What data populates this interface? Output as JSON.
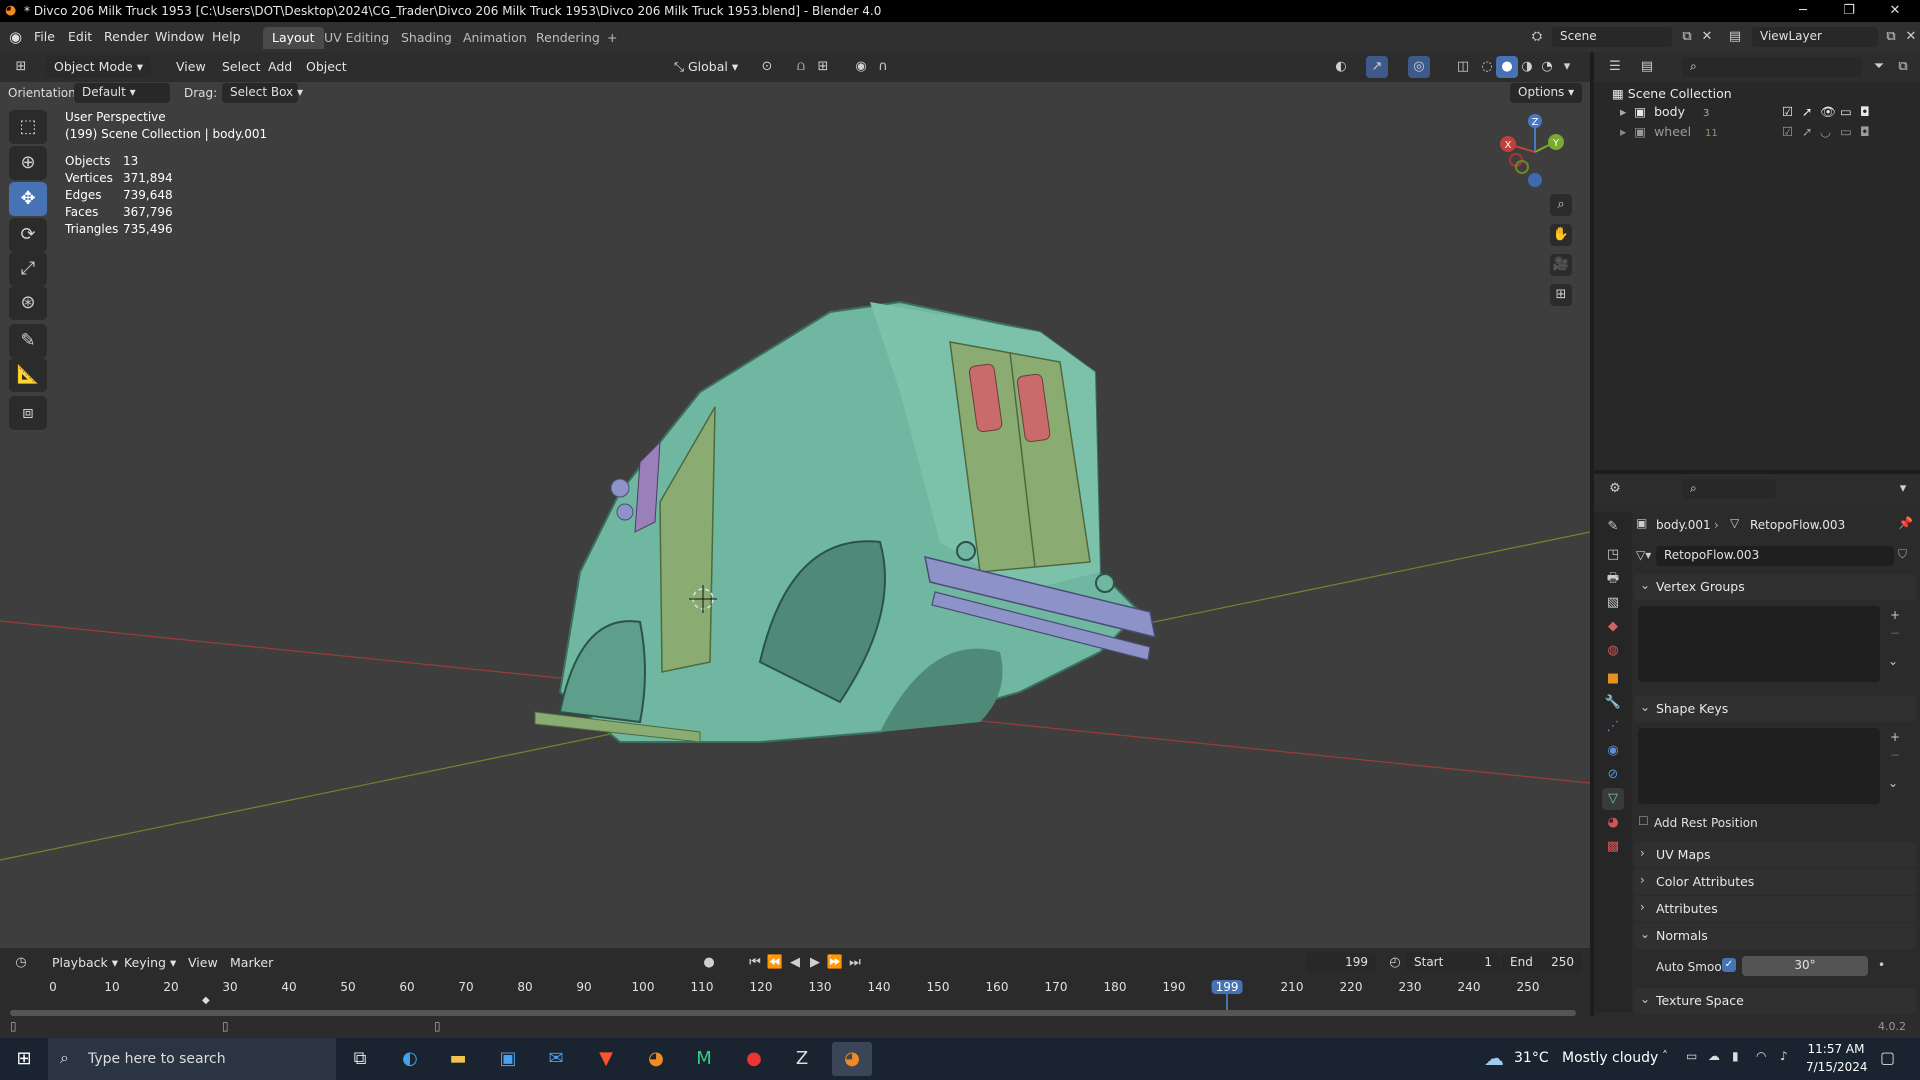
{
  "window": {
    "title": "* Divco 206 Milk Truck 1953 [C:\\Users\\DOT\\Desktop\\2024\\CG_Trader\\Divco 206 Milk Truck 1953\\Divco 206 Milk Truck 1953.blend] - Blender 4.0",
    "minimize": "─",
    "restore": "❐",
    "close": "✕"
  },
  "menu": [
    "File",
    "Edit",
    "Render",
    "Window",
    "Help"
  ],
  "workspaces": [
    "Layout",
    "UV Editing",
    "Shading",
    "Animation",
    "Rendering"
  ],
  "workspace_add": "+",
  "scene": {
    "name": "Scene",
    "viewlayer": "ViewLayer"
  },
  "viewport_header": {
    "mode": "Object Mode",
    "menus": [
      "View",
      "Select",
      "Add",
      "Object"
    ],
    "transform": "Global",
    "options": "Options"
  },
  "tool_settings": {
    "orientation_label": "Orientation:",
    "orientation_value": "Default",
    "drag_label": "Drag:",
    "drag_value": "Select Box"
  },
  "overlay_info": {
    "perspective": "User Perspective",
    "collection": "(199) Scene Collection | body.001",
    "stats": [
      {
        "label": "Objects",
        "value": "13"
      },
      {
        "label": "Vertices",
        "value": "371,894"
      },
      {
        "label": "Edges",
        "value": "739,648"
      },
      {
        "label": "Faces",
        "value": "367,796"
      },
      {
        "label": "Triangles",
        "value": "735,496"
      }
    ]
  },
  "gizmo": {
    "x": "X",
    "y": "Y",
    "z": "Z"
  },
  "tools": [
    "select-box-icon",
    "cursor-icon",
    "move-icon",
    "rotate-icon",
    "scale-icon",
    "transform-icon",
    "annotate-icon",
    "measure-icon",
    "add-cube-icon"
  ],
  "outliner": {
    "root": "Scene Collection",
    "items": [
      {
        "name": "body",
        "badge": "3"
      },
      {
        "name": "wheel",
        "badge": "11"
      }
    ]
  },
  "properties": {
    "breadcrumb_object": "body.001",
    "breadcrumb_data": "RetopoFlow.003",
    "datablock": "RetopoFlow.003",
    "sections": {
      "vertex_groups": "Vertex Groups",
      "shape_keys": "Shape Keys",
      "add_rest_position": "Add Rest Position",
      "uv_maps": "UV Maps",
      "color_attributes": "Color Attributes",
      "attributes": "Attributes",
      "normals": "Normals",
      "auto_smooth": "Auto Smooth",
      "auto_smooth_angle": "30°",
      "texture_space": "Texture Space"
    }
  },
  "timeline": {
    "menus": [
      "Playback",
      "Keying",
      "View",
      "Marker"
    ],
    "current_frame": "199",
    "start_label": "Start",
    "start": "1",
    "end_label": "End",
    "end": "250",
    "ticks": [
      "0",
      "10",
      "20",
      "30",
      "40",
      "50",
      "60",
      "70",
      "80",
      "90",
      "100",
      "110",
      "120",
      "130",
      "140",
      "150",
      "160",
      "170",
      "180",
      "190",
      "199",
      "210",
      "220",
      "230",
      "240",
      "250"
    ]
  },
  "status": {
    "version": "4.0.2"
  },
  "taskbar": {
    "search_placeholder": "Type here to search",
    "weather_temp": "31°C",
    "weather_desc": "Mostly cloudy",
    "time": "11:57 AM",
    "date": "7/15/2024"
  },
  "colors": {
    "accent": "#4772b3",
    "truck_body": "#6fb7a0",
    "truck_panel": "#8aac72",
    "window_red": "#c96b6b",
    "bumper": "#8d93c8",
    "axis_x": "#9c3b3b",
    "axis_y": "#6a8a2a"
  }
}
